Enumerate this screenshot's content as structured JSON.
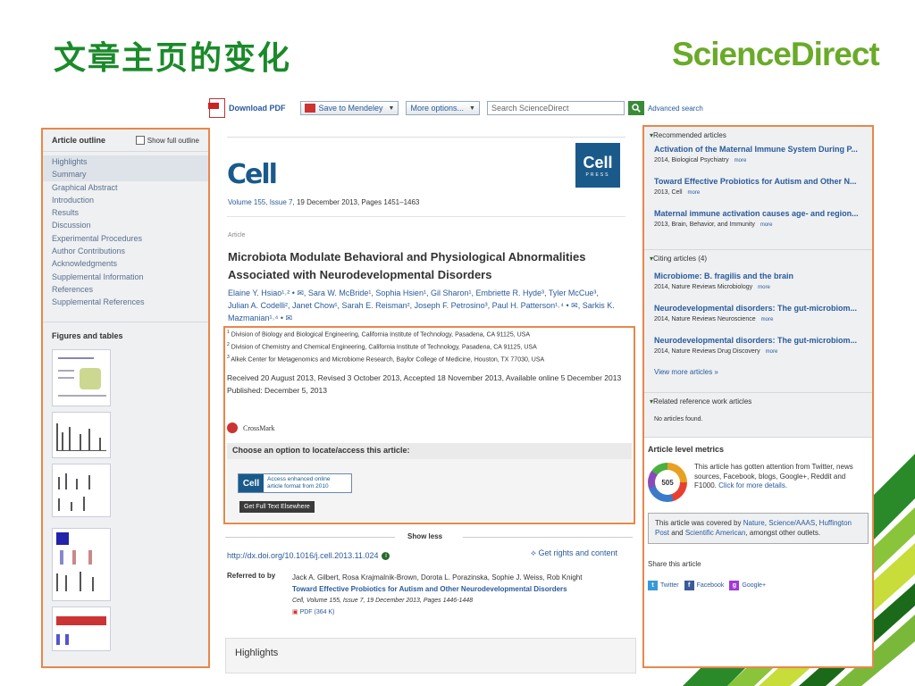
{
  "slide": {
    "title": "文章主页的变化",
    "logo": "ScienceDirect"
  },
  "toolbar": {
    "download_pdf": "Download PDF",
    "save_mendeley": "Save to Mendeley",
    "more_options": "More options...",
    "search_placeholder": "Search ScienceDirect",
    "advanced_search": "Advanced search"
  },
  "outline": {
    "title": "Article outline",
    "show_full": "Show full outline",
    "items": [
      "Highlights",
      "Summary",
      "Graphical Abstract",
      "Introduction",
      "Results",
      "Discussion",
      "Experimental Procedures",
      "Author Contributions",
      "Acknowledgments",
      "Supplemental Information",
      "References",
      "Supplemental References"
    ],
    "figures_title": "Figures and tables"
  },
  "article": {
    "journal": "Cell",
    "badge": "Cell",
    "badge_sub": "PRESS",
    "volume_link": "Volume 155, Issue 7,",
    "volume_rest": " 19 December 2013, Pages 1451–1463",
    "label": "Article",
    "title": "Microbiota Modulate Behavioral and Physiological Abnormalities Associated with Neurodevelopmental Disorders",
    "authors": "Elaine Y. Hsiao¹˒² • ✉, Sara W. McBride¹, Sophia Hsien¹, Gil Sharon¹, Embriette R. Hyde³, Tyler McCue³, Julian A. Codelli², Janet Chow¹, Sarah E. Reisman², Joseph F. Petrosino³, Paul H. Patterson¹˒⁴ • ✉, Sarkis K. Mazmanian¹˒⁴ • ✉",
    "affiliations": [
      {
        "n": "1",
        "t": "Division of Biology and Biological Engineering, California Institute of Technology, Pasadena, CA 91125, USA"
      },
      {
        "n": "2",
        "t": "Division of Chemistry and Chemical Engineering, California Institute of Technology, Pasadena, CA 91125, USA"
      },
      {
        "n": "3",
        "t": "Alkek Center for Metagenomics and Microbiome Research, Baylor College of Medicine, Houston, TX 77030, USA"
      }
    ],
    "dates": "Received 20 August 2013, Revised 3 October 2013, Accepted 18 November 2013, Available online 5 December 2013",
    "published": "Published: December 5, 2013",
    "crossmark": "CrossMark",
    "choose": "Choose an option to locate/access this article:",
    "access_logo": "Cell",
    "access_text_1": "Access enhanced online",
    "access_text_2": "article format from 2010",
    "full_text": "Get Full Text Elsewhere",
    "show_less": "Show less",
    "doi": "http://dx.doi.org/10.1016/j.cell.2013.11.024",
    "rights": "Get rights and content",
    "referred_label": "Referred to by",
    "referred_authors": "Jack A. Gilbert, Rosa Krajmalnik-Brown, Dorota L. Porazinska, Sophie J. Weiss, Rob Knight",
    "referred_title": "Toward Effective Probiotics for Autism and Other Neurodevelopmental Disorders",
    "referred_cite": "Cell, Volume 155, Issue 7, 19 December 2013, Pages 1446-1448",
    "referred_pdf": "PDF (364 K)",
    "highlights": "Highlights"
  },
  "right": {
    "recommended_title": "Recommended articles",
    "recommended": [
      {
        "t": "Activation of the Maternal Immune System During P...",
        "m": "2014, Biological Psychiatry"
      },
      {
        "t": "Toward Effective Probiotics for Autism and Other N...",
        "m": "2013, Cell"
      },
      {
        "t": "Maternal immune activation causes age- and region...",
        "m": "2013, Brain, Behavior, and Immunity"
      }
    ],
    "citing_title": "Citing articles (4)",
    "citing": [
      {
        "t": "Microbiome: B. fragilis and the brain",
        "m": "2014, Nature Reviews Microbiology"
      },
      {
        "t": "Neurodevelopmental disorders: The gut-microbiom...",
        "m": "2014, Nature Reviews Neuroscience"
      },
      {
        "t": "Neurodevelopmental disorders: The gut-microbiom...",
        "m": "2014, Nature Reviews Drug Discovery"
      }
    ],
    "more_label": "more",
    "view_more": "View more articles »",
    "related_title": "Related reference work articles",
    "related_none": "No articles found.",
    "metrics_title": "Article level metrics",
    "altmetric_score": "505",
    "metrics_text": "This article has gotten attention from Twitter, news sources, Facebook, blogs, Google+, Reddit and F1000.",
    "metrics_link": "Click for more details.",
    "covered_1": "This article was covered by",
    "covered_nature": "Nature",
    "covered_sci": "Science/AAAS",
    "covered_huff": "Huffington Post",
    "covered_and": "and",
    "covered_sa": "Scientific American",
    "covered_end": ", amongst other outlets.",
    "share_title": "Share this article",
    "twitter": "Twitter",
    "facebook": "Facebook",
    "googleplus": "Google+"
  },
  "colors": {
    "title_green": "#1a8a2a",
    "logo_green": "#6aaa2a",
    "highlight_box": "#e8874a",
    "link_blue": "#2a5a9a",
    "cell_blue": "#1a5a8a"
  }
}
